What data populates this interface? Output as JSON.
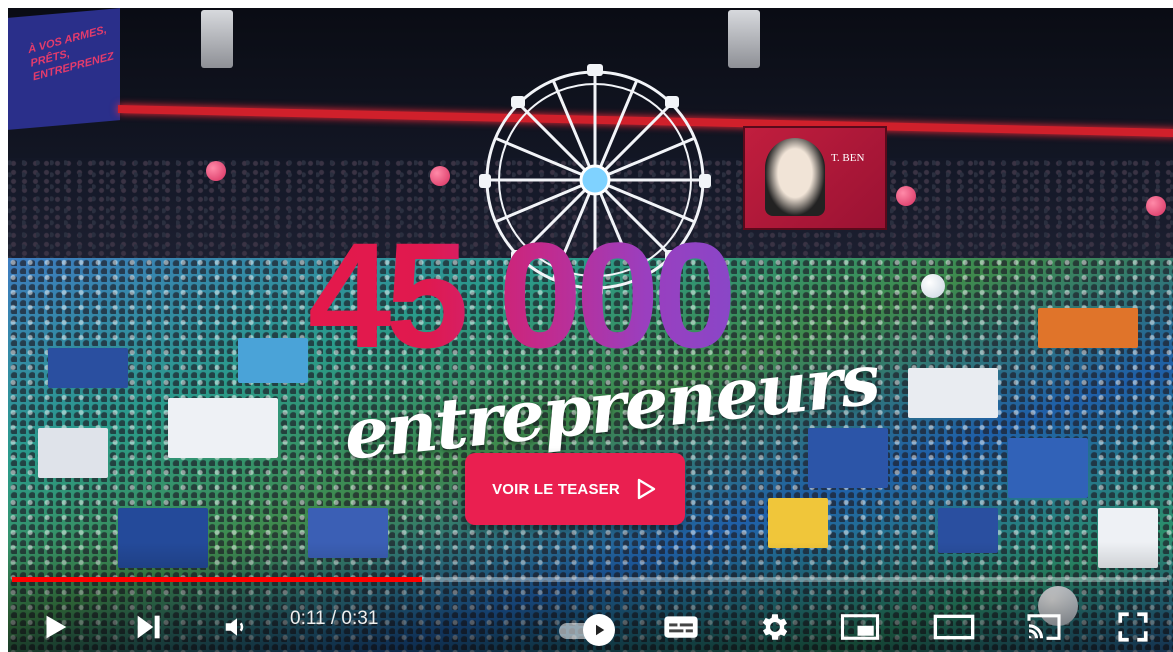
{
  "video": {
    "title_number": "45 000",
    "title_word": "entrepreneurs",
    "cta_label": "VOIR LE TEASER",
    "cta_icon": "play-outline-icon",
    "corner_banner_text": "À VOS ARMES, PRÊTS, ENTREPRENEZ",
    "poster_text": "T. BEN",
    "accent_color": "#ea1f50"
  },
  "player": {
    "progress_fraction": 0.355,
    "progress_color": "#ff0000",
    "time_display": "0:11 / 0:31",
    "controls": {
      "play": "play-icon",
      "next": "next-icon",
      "volume": "volume-icon",
      "autoplay": "autoplay-toggle-icon",
      "subtitles": "subtitles-icon",
      "settings": "gear-icon",
      "miniplayer": "miniplayer-icon",
      "theater": "theater-mode-icon",
      "cast": "cast-icon",
      "fullscreen": "fullscreen-icon"
    }
  }
}
